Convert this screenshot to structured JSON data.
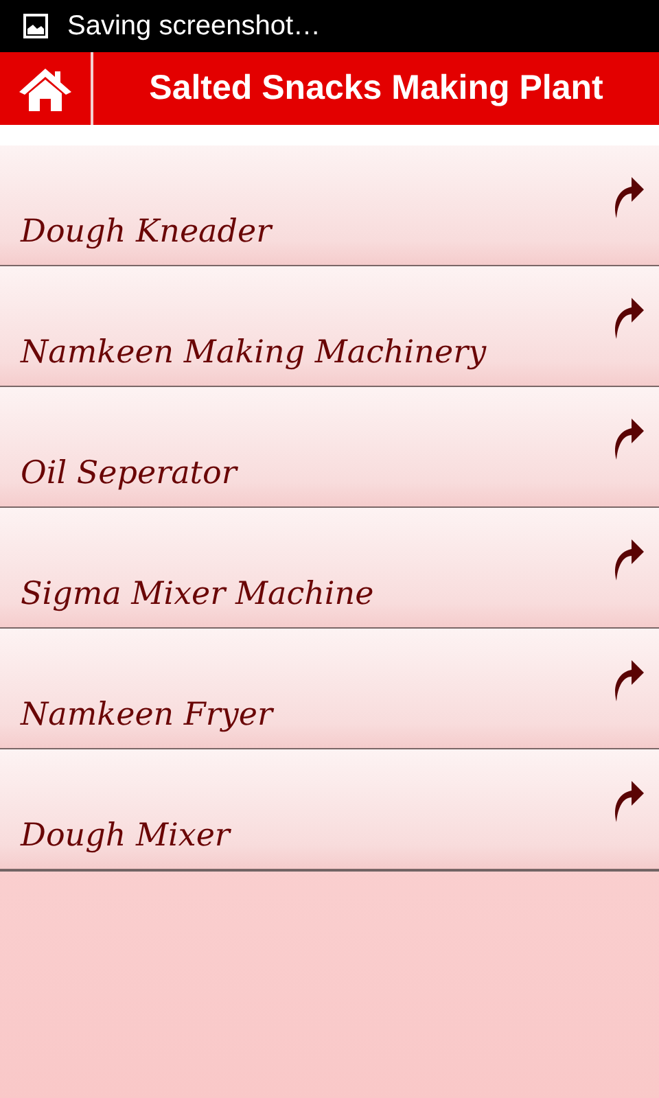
{
  "status_bar": {
    "notification": "Saving screenshot…"
  },
  "header": {
    "title": "Salted Snacks Making Plant"
  },
  "items": [
    {
      "label": "Dough Kneader"
    },
    {
      "label": "Namkeen Making Machinery"
    },
    {
      "label": "Oil Seperator"
    },
    {
      "label": "Sigma Mixer Machine"
    },
    {
      "label": "Namkeen Fryer"
    },
    {
      "label": "Dough Mixer"
    }
  ]
}
